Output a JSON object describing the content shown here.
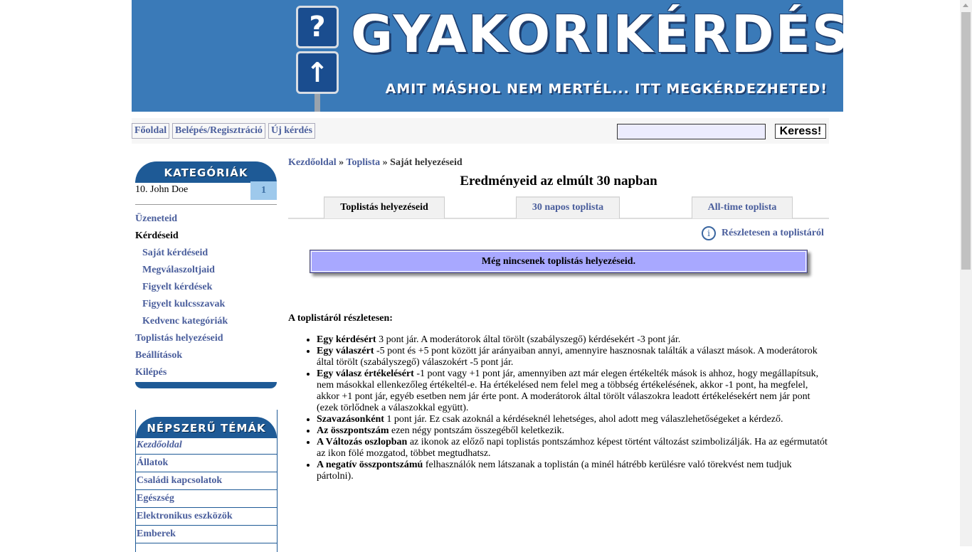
{
  "header": {
    "site_title": "gyakorikérdések.hu",
    "slogan": "amit máshol nem mertél... itt megkérdezheted!",
    "question_sign": "?",
    "arrow_sign": "↑"
  },
  "nav": {
    "items": [
      {
        "label": "Főoldal"
      },
      {
        "label": "Belépés/Regisztráció"
      },
      {
        "label": "Új kérdés"
      }
    ],
    "search": {
      "value": "",
      "placeholder": "",
      "button": "Keress!"
    }
  },
  "sidebar": {
    "categories_header": "Kategóriák",
    "user_line": "10. John Doe",
    "user_rank": "1",
    "links": [
      {
        "label": "Üzeneteid"
      },
      {
        "label": "Kérdéseid"
      },
      {
        "label": "Saját kérdéseid"
      },
      {
        "label": "Megválaszoltjaid"
      },
      {
        "label": "Figyelt kérdések"
      },
      {
        "label": "Figyelt kulcsszavak"
      },
      {
        "label": "Kedvenc kategóriák"
      },
      {
        "label": "Toplistás helyezéseid"
      },
      {
        "label": "Beállítások"
      },
      {
        "label": "Kilépés"
      }
    ],
    "popular_header": "Népszerű témák",
    "topics": [
      {
        "label": "Kezdőoldal"
      },
      {
        "label": "Állatok"
      },
      {
        "label": "Családi kapcsolatok"
      },
      {
        "label": "Egészség"
      },
      {
        "label": "Elektronikus eszközök"
      },
      {
        "label": "Emberek"
      }
    ]
  },
  "main": {
    "breadcrumb": {
      "home": "Kezdőoldal",
      "sep1": " » ",
      "toplist": "Toplista",
      "sep2": " » ",
      "current": "Saját helyezéseid"
    },
    "title": "Eredményeid az elmúlt 30 napban",
    "tabs": [
      {
        "label": "Toplistás helyezéseid"
      },
      {
        "label": "30 napos toplista"
      },
      {
        "label": "All-time toplista"
      }
    ],
    "details_link": "Részletesen a toplistáról",
    "info_glyph": "i",
    "notice": "Még nincsenek toplistás helyezéseid.",
    "rules_title": "A toplistáról részletesen:",
    "rules": [
      {
        "bold": "Egy kérdésért",
        "text": " 3 pont jár. A moderátorok által törölt (szabályszegő) kérdésekért -3 pont jár."
      },
      {
        "bold": "Egy válaszért",
        "text": " -5 pont és +5 pont között jár arányaiban annyi, amennyire hasznosnak találták a választ mások. A moderátorok által törölt (szabályszegő) válaszokért -5 pont jár."
      },
      {
        "bold": "Egy válasz értékelésért",
        "text": " -1 pont vagy +1 pont jár, amennyiben azt már elegen értékelték mások is ahhoz, hogy megállapítsuk, nem másokkal ellenkezőleg értékeltél-e. Ha értékelésed nem felel meg a többség értékelésének, akkor -1 pont, ha megfelel, akkor +1 pont jár, egyéb esetben nem jár érte pont. A moderátorok által törölt válaszokra leadott értékelésekért nem jár pont (ezek törlődnek a válaszokkal együtt)."
      },
      {
        "bold": "Szavazásonként",
        "text": " 1 pont jár. Ez csak azoknál a kérdéseknél lehetséges, ahol adott meg válaszlehetőségeket a kérdező."
      },
      {
        "bold": "Az összpontszám",
        "text": " ezen négy pontszám összegéből keletkezik."
      },
      {
        "bold": "A Változás oszlopban",
        "text": " az ikonok az előző napi toplistás pontszámhoz képest történt változást szimbolizálják. Ha az egérmutatót az ikon fölé mozgatod, többet megtudhatsz."
      },
      {
        "bold": "A negatív összpontszámú",
        "text": " felhasználók nem látszanak a toplistán (a minél hátrébb kerülésre való törekvést nem tudjuk pártolni)."
      }
    ]
  }
}
